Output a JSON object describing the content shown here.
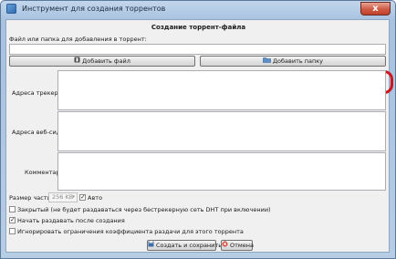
{
  "window": {
    "title": "Инструмент для создания торрентов",
    "close_glyph": "x"
  },
  "dialog": {
    "heading": "Создание торрент-файла",
    "source_label": "Файл или папка для добавления в торрент:",
    "source_value": "",
    "add_file_label": "Добавить файл",
    "add_folder_label": "Добавить папку",
    "trackers_label": "Адреса трекеров:",
    "trackers_value": "",
    "webseeds_label": "Адреса веб-сидов:",
    "webseeds_value": "",
    "comment_label": "Комментарий:",
    "comment_value": "",
    "piece_size_label": "Размер части:",
    "piece_size_value": "256 KB",
    "auto_label": "Авто",
    "auto_checked": "✓",
    "private_label": "Закрытый (не будет раздаваться через бестрекерную сеть DHT при включении)",
    "private_checked": "",
    "start_seeding_label": "Начать раздавать после создания",
    "start_seeding_checked": "✓",
    "ignore_ratio_label": "Игнорировать ограничения коэффициента раздачи для этого торрента",
    "ignore_ratio_checked": "",
    "create_save_label": "Создать и сохранить...",
    "cancel_label": "Отмена"
  },
  "colors": {
    "highlight": "#d0161b",
    "titlebar": "#b7cde6"
  }
}
